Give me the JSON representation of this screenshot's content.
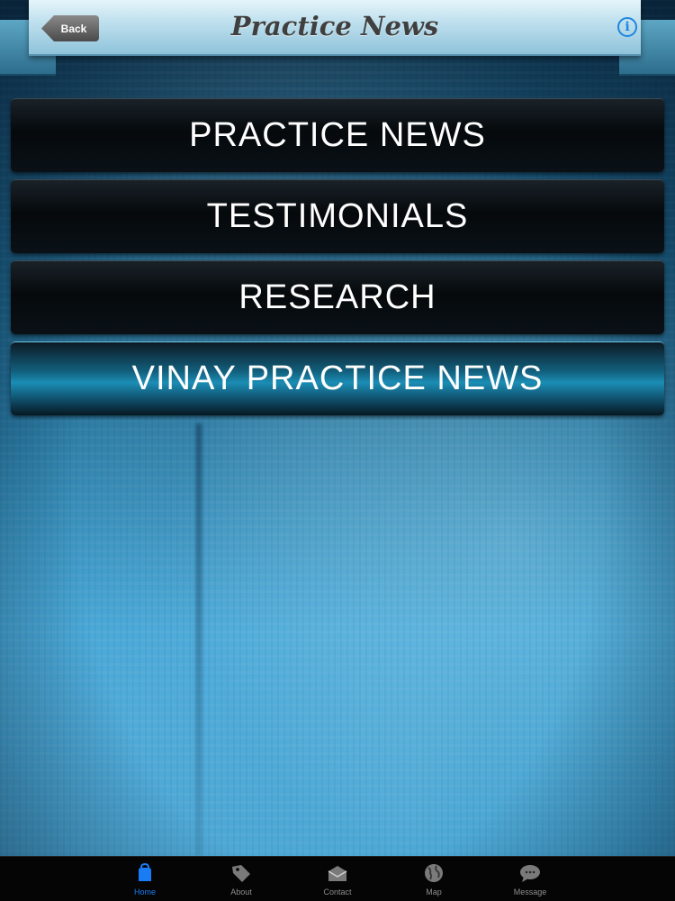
{
  "header": {
    "title": "Practice News",
    "back_label": "Back",
    "info_icon": "info-icon"
  },
  "menu": {
    "items": [
      {
        "label": "PRACTICE NEWS"
      },
      {
        "label": "TESTIMONIALS"
      },
      {
        "label": "RESEARCH"
      },
      {
        "label": "VINAY PRACTICE NEWS",
        "selected": true
      }
    ]
  },
  "tabbar": {
    "tabs": [
      {
        "label": "Home",
        "icon": "home-icon",
        "active": true
      },
      {
        "label": "About",
        "icon": "tag-icon"
      },
      {
        "label": "Contact",
        "icon": "envelope-icon"
      },
      {
        "label": "Map",
        "icon": "globe-icon"
      },
      {
        "label": "Message",
        "icon": "chat-bubble-icon"
      }
    ]
  },
  "colors": {
    "accent": "#1a7cf5",
    "title_text": "#3f3f3f",
    "menu_text": "#ffffff"
  }
}
